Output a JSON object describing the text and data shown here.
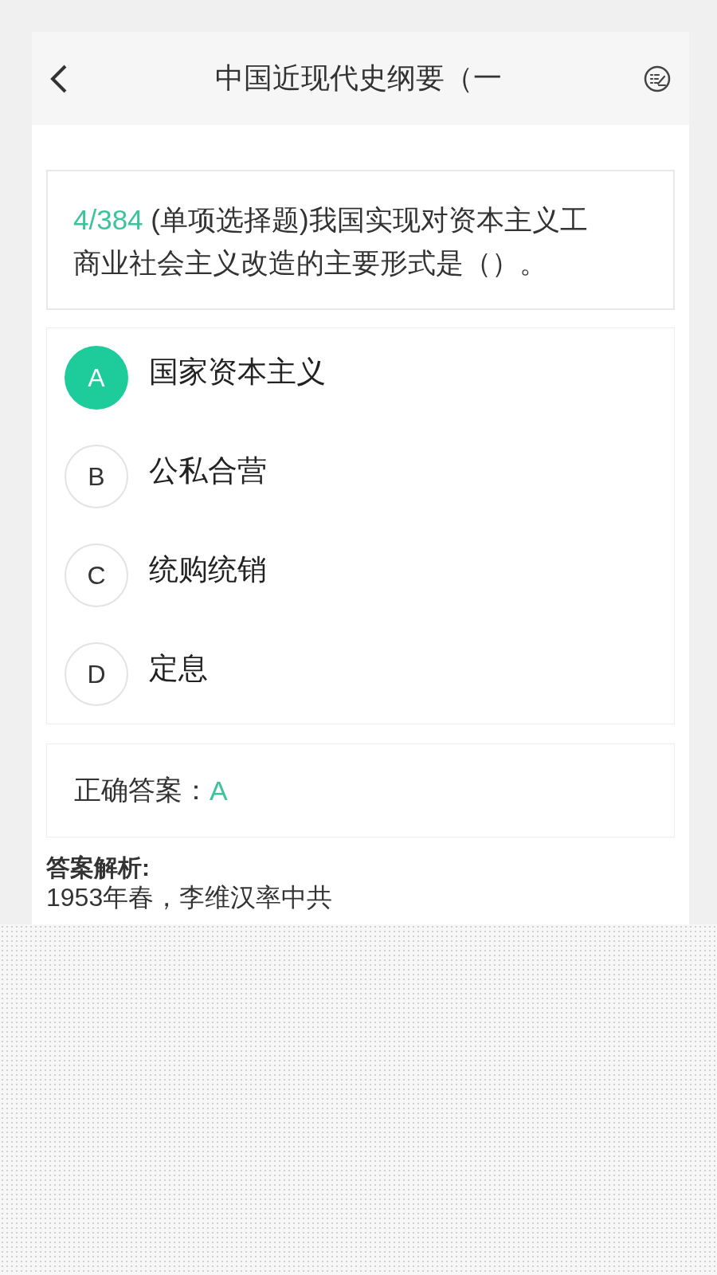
{
  "header": {
    "title": "中国近现代史纲要（一"
  },
  "question": {
    "number": "4/384",
    "text": "(单项选择题)我国实现对资本主义工商业社会主义改造的主要形式是（）。"
  },
  "options": [
    {
      "letter": "A",
      "text": "国家资本主义",
      "selected": true
    },
    {
      "letter": "B",
      "text": "公私合营",
      "selected": false
    },
    {
      "letter": "C",
      "text": "统购统销",
      "selected": false
    },
    {
      "letter": "D",
      "text": "定息",
      "selected": false
    }
  ],
  "answer": {
    "label": "正确答案：",
    "value": "A"
  },
  "analysis": {
    "heading": "答案解析:",
    "text": "1953年春，李维汉率中共"
  }
}
